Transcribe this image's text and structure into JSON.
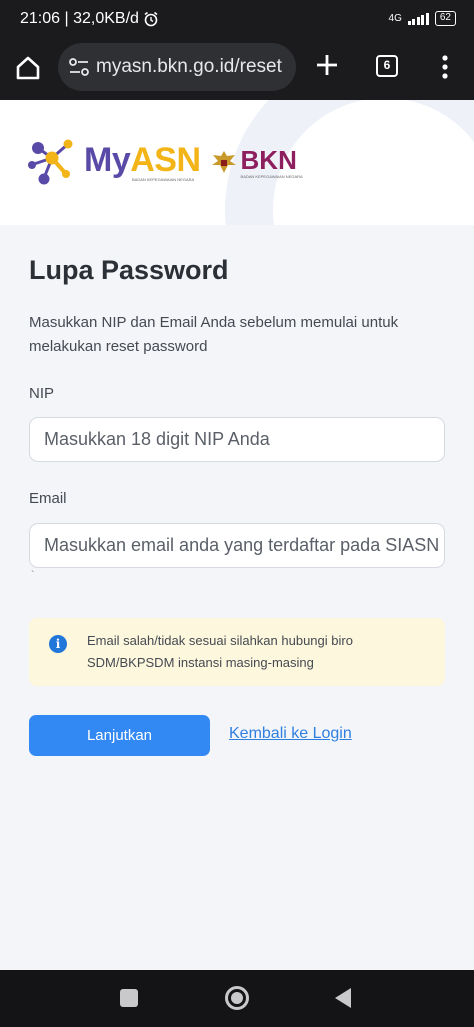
{
  "status_bar": {
    "time_speed": "21:06 | 32,0KB/d",
    "network": "4G",
    "battery": "62"
  },
  "browser": {
    "url": "myasn.bkn.go.id/reset",
    "tab_count": "6"
  },
  "logo": {
    "myasn_my": "My",
    "myasn_asn": "ASN",
    "myasn_sub": "BADAN KEPEGAWAIAN NEGARA",
    "bkn": "BKN",
    "bkn_sub": "BADAN KEPEGAWAIAN NEGARA"
  },
  "form": {
    "title": "Lupa Password",
    "description": "Masukkan NIP dan Email Anda sebelum memulai untuk melakukan reset password",
    "nip_label": "NIP",
    "nip_placeholder": "Masukkan 18 digit NIP Anda",
    "email_label": "Email",
    "email_placeholder": "Masukkan email anda yang terdaftar pada SIASN",
    "alert_text": "Email salah/tidak sesuai silahkan hubungi biro SDM/BKPSDM instansi masing-masing",
    "submit_label": "Lanjutkan",
    "back_link": "Kembali ke Login"
  },
  "colors": {
    "primary": "#3389f3",
    "link": "#2f7fe0",
    "alert_bg": "#fdf7dd",
    "info_icon": "#2176d9",
    "asn_yellow": "#f2b416",
    "my_purple": "#5a4aa8",
    "bkn_maroon": "#8e1f5f"
  }
}
